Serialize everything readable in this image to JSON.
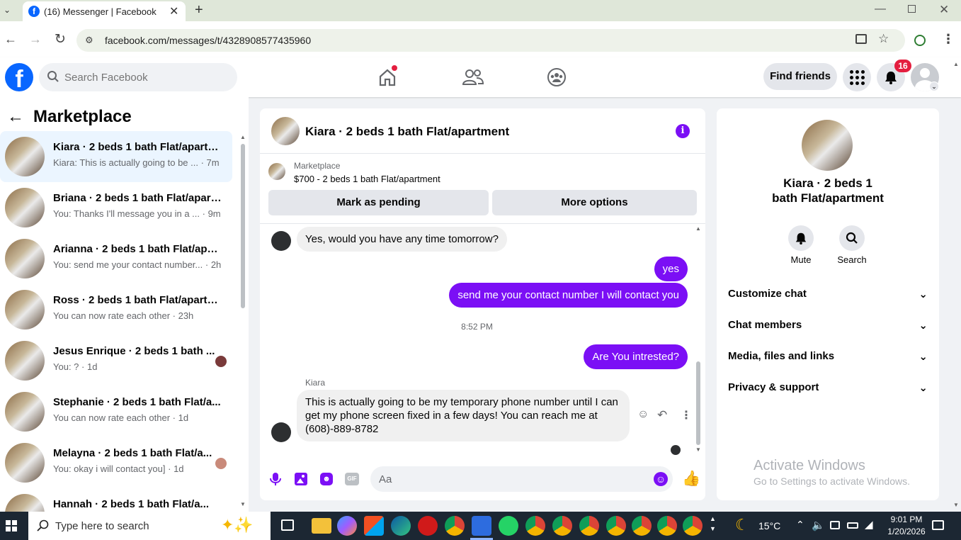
{
  "browser": {
    "tab_title": "(16) Messenger | Facebook",
    "url": "facebook.com/messages/t/4328908577435960"
  },
  "header": {
    "search_placeholder": "Search Facebook",
    "find_friends": "Find friends",
    "notification_count": "16"
  },
  "sidebar": {
    "title": "Marketplace",
    "conversations": [
      {
        "name": "Kiara · 2 beds 1 bath Flat/apartm...",
        "preview": "Kiara: This is actually going to be ...",
        "time": "· 7m"
      },
      {
        "name": "Briana · 2 beds 1 bath Flat/apart...",
        "preview": "You: Thanks I'll message you in a ...",
        "time": "· 9m"
      },
      {
        "name": "Arianna · 2 beds 1 bath Flat/apar...",
        "preview": "You: send me your contact number...",
        "time": "· 2h"
      },
      {
        "name": "Ross · 2 beds 1 bath Flat/apartm...",
        "preview": "You can now rate each other",
        "time": "· 23h"
      },
      {
        "name": "Jesus Enrique · 2 beds 1 bath ...",
        "preview": "You: ?",
        "time": "· 1d"
      },
      {
        "name": "Stephanie · 2 beds 1 bath Flat/a...",
        "preview": "You can now rate each other",
        "time": "· 1d"
      },
      {
        "name": "Melayna · 2 beds 1 bath Flat/a...",
        "preview": "You: okay i will contact you]",
        "time": "· 1d"
      },
      {
        "name": "Hannah · 2 beds 1 bath Flat/a...",
        "preview": "",
        "time": ""
      }
    ]
  },
  "chat": {
    "title": "Kiara · 2 beds 1 bath Flat/apartment",
    "listing_source": "Marketplace",
    "listing_title": "$700 - 2 beds 1 bath Flat/apartment",
    "mark_pending": "Mark as pending",
    "more_options": "More options",
    "messages": {
      "m1": "Yes, would you have any time tomorrow?",
      "m2": "yes",
      "m3": "send me your contact number I will contact you",
      "timestamp": "8:52 PM",
      "m4": "Are You intrested?",
      "sender": "Kiara",
      "m5": "This is actually going to be my temporary phone number until I can get my phone screen fixed in a few days! You can reach me at (608)-889-8782"
    },
    "composer_placeholder": "Aa"
  },
  "details": {
    "name": "Kiara · 2 beds 1 bath Flat/apartment",
    "mute": "Mute",
    "search": "Search",
    "sections": [
      "Customize chat",
      "Chat members",
      "Media, files and links",
      "Privacy & support"
    ]
  },
  "watermark": {
    "title": "Activate Windows",
    "subtitle": "Go to Settings to activate Windows."
  },
  "taskbar": {
    "search_placeholder": "Type here to search",
    "weather": "15°C",
    "time": "9:01 PM",
    "date": "1/20/2026"
  },
  "colors": {
    "accent": "#7b0ff5",
    "facebook_blue": "#0866ff",
    "notification_red": "#e41e3f"
  }
}
